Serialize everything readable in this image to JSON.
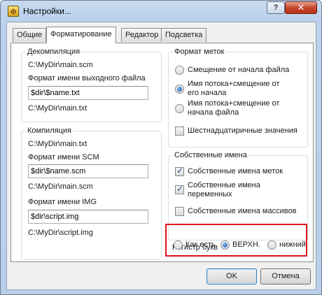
{
  "window": {
    "title": "Настройки...",
    "app_icon_glyph": "ф",
    "help_glyph": "?",
    "close_glyph": "✕"
  },
  "tabs": [
    {
      "label": "Общие",
      "active": false
    },
    {
      "label": "Форматирование",
      "active": true
    },
    {
      "label": "Редактор",
      "active": false
    },
    {
      "label": "Подсветка",
      "active": false
    }
  ],
  "decompilation": {
    "title": "Декомпиляция",
    "path": "C:\\MyDir\\main.scm",
    "output_format_label": "Формат имени выходного файла",
    "output_format_value": "$dir\\$name.txt",
    "output_preview": "C:\\MyDir\\main.txt"
  },
  "compilation": {
    "title": "Компиляция",
    "path": "C:\\MyDir\\main.txt",
    "scm_format_label": "Формат имени SCM",
    "scm_format_value": "$dir\\$name.scm",
    "scm_preview": "C:\\MyDir\\main.scm",
    "img_format_label": "Формат имени IMG",
    "img_format_value": "$dir\\script.img",
    "img_preview": "C:\\MyDir\\script.img"
  },
  "label_format": {
    "title": "Формат меток",
    "options": [
      {
        "label": "Смещение от начала файла",
        "selected": false
      },
      {
        "label_line1": "Имя потока+смещение от",
        "label_line2": "его начала",
        "selected": true
      },
      {
        "label_line1": "Имя потока+смещение от",
        "label_line2": "начала файла",
        "selected": false
      }
    ],
    "hex_values": {
      "label": "Шестнадцатиричные значения",
      "checked": false
    }
  },
  "own_names": {
    "title": "Собственные имена",
    "label_names": {
      "label": "Собственные имена меток",
      "checked": true
    },
    "variable_names": {
      "label_line1": "Собственные имена",
      "label_line2": "переменных",
      "checked": true
    },
    "array_names": {
      "label": "Собственные имена массивов",
      "checked": false
    }
  },
  "letter_case": {
    "title": "Регистр букв",
    "options": [
      {
        "label": "Как есть",
        "selected": false
      },
      {
        "label": "ВЕРХН.",
        "selected": true
      },
      {
        "label": "нижний",
        "selected": false
      }
    ],
    "highlight_color": "#e0131a"
  },
  "buttons": {
    "ok": "OK",
    "cancel": "Отмена"
  }
}
